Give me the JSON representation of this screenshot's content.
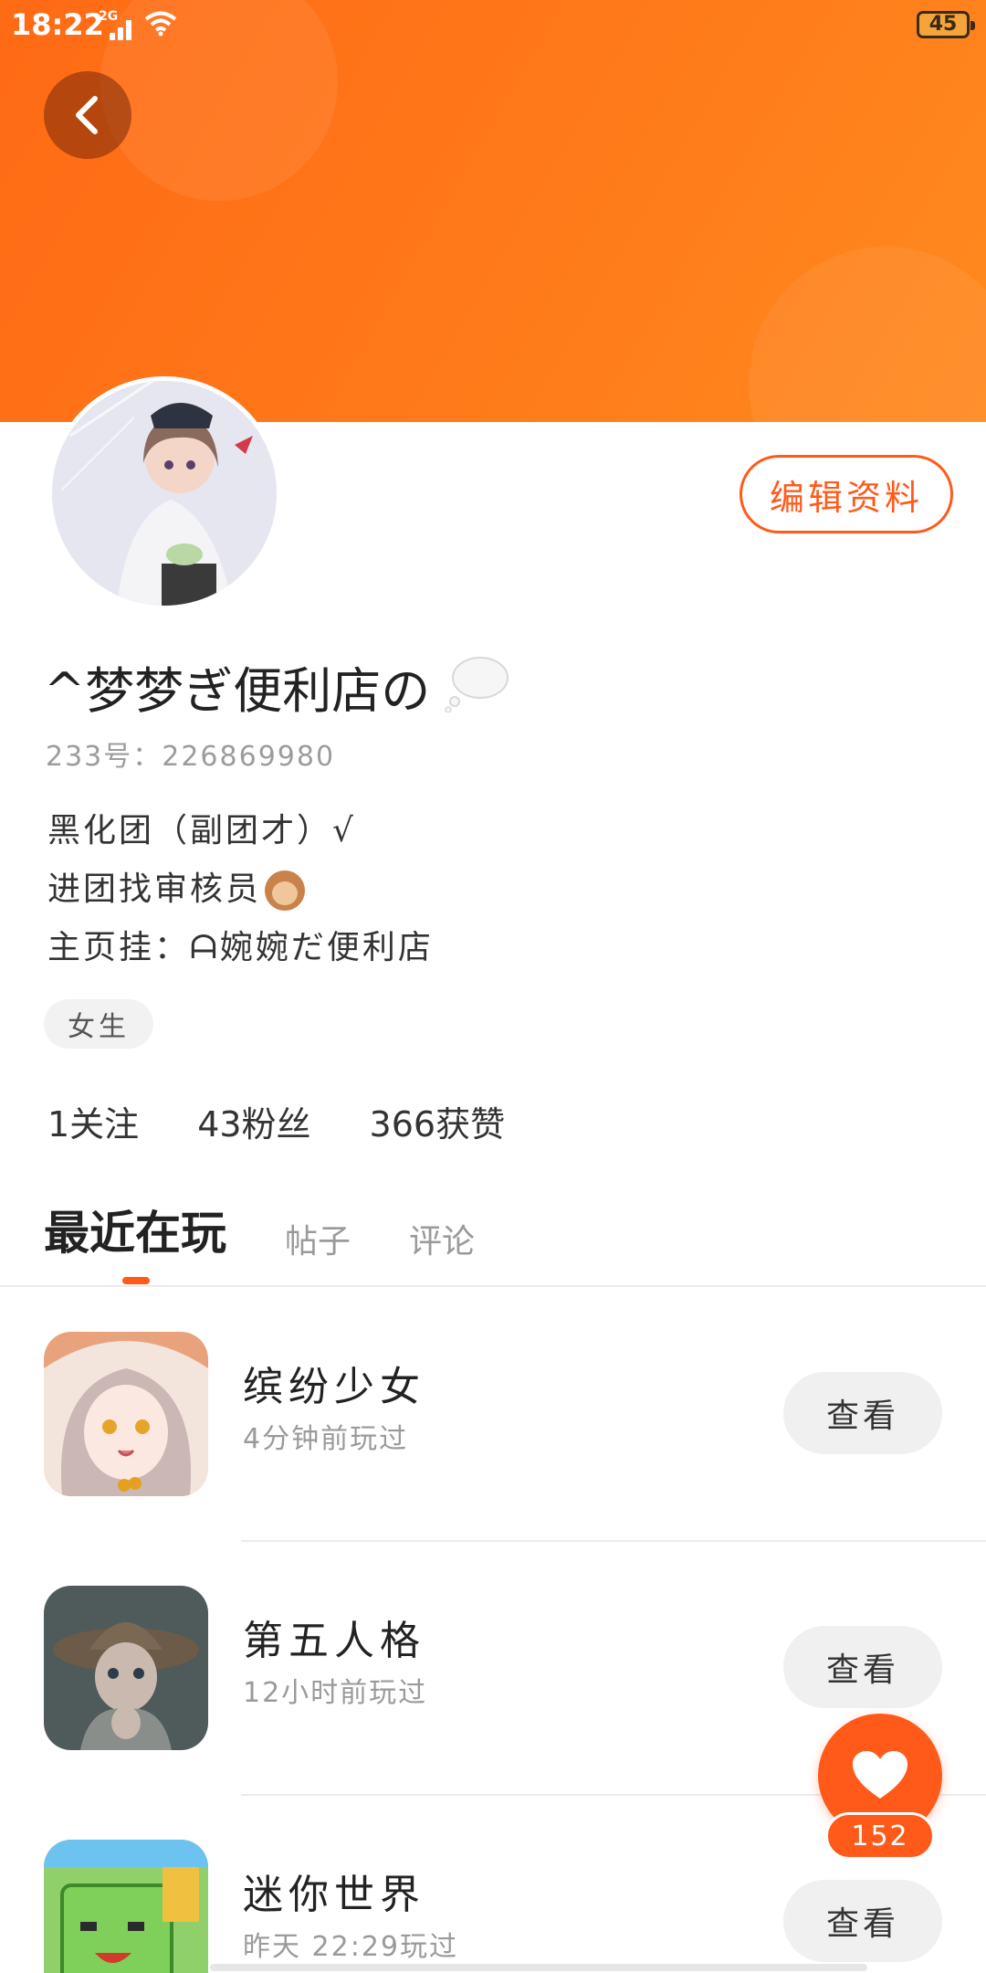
{
  "status_bar": {
    "time": "18:22",
    "network": "2G",
    "battery": "45"
  },
  "profile": {
    "edit_label": "编辑资料",
    "username": "^梦梦ぎ便利店の",
    "uid": "233号：226869980",
    "bio": [
      "黑化团（副团才）√",
      "进团找审核员",
      "主页挂：ᗩ婉婉だ便利店"
    ],
    "gender": "女生",
    "stats": {
      "following": "1关注",
      "fans": "43粉丝",
      "likes": "366获赞"
    }
  },
  "tabs": [
    "最近在玩",
    "帖子",
    "评论"
  ],
  "games": [
    {
      "name": "缤纷少女",
      "time": "4分钟前玩过",
      "button": "查看"
    },
    {
      "name": "第五人格",
      "time": "12小时前玩过",
      "button": "查看"
    },
    {
      "name": "迷你世界",
      "time": "昨天 22:29玩过",
      "button": "查看"
    }
  ],
  "like_count": "152",
  "colors": {
    "accent": "#ff5a1a",
    "header": "#ff7a1a"
  },
  "icons": {
    "back": "chevron-left-icon",
    "thought": "thought-bubble-icon",
    "like": "heart-icon"
  }
}
